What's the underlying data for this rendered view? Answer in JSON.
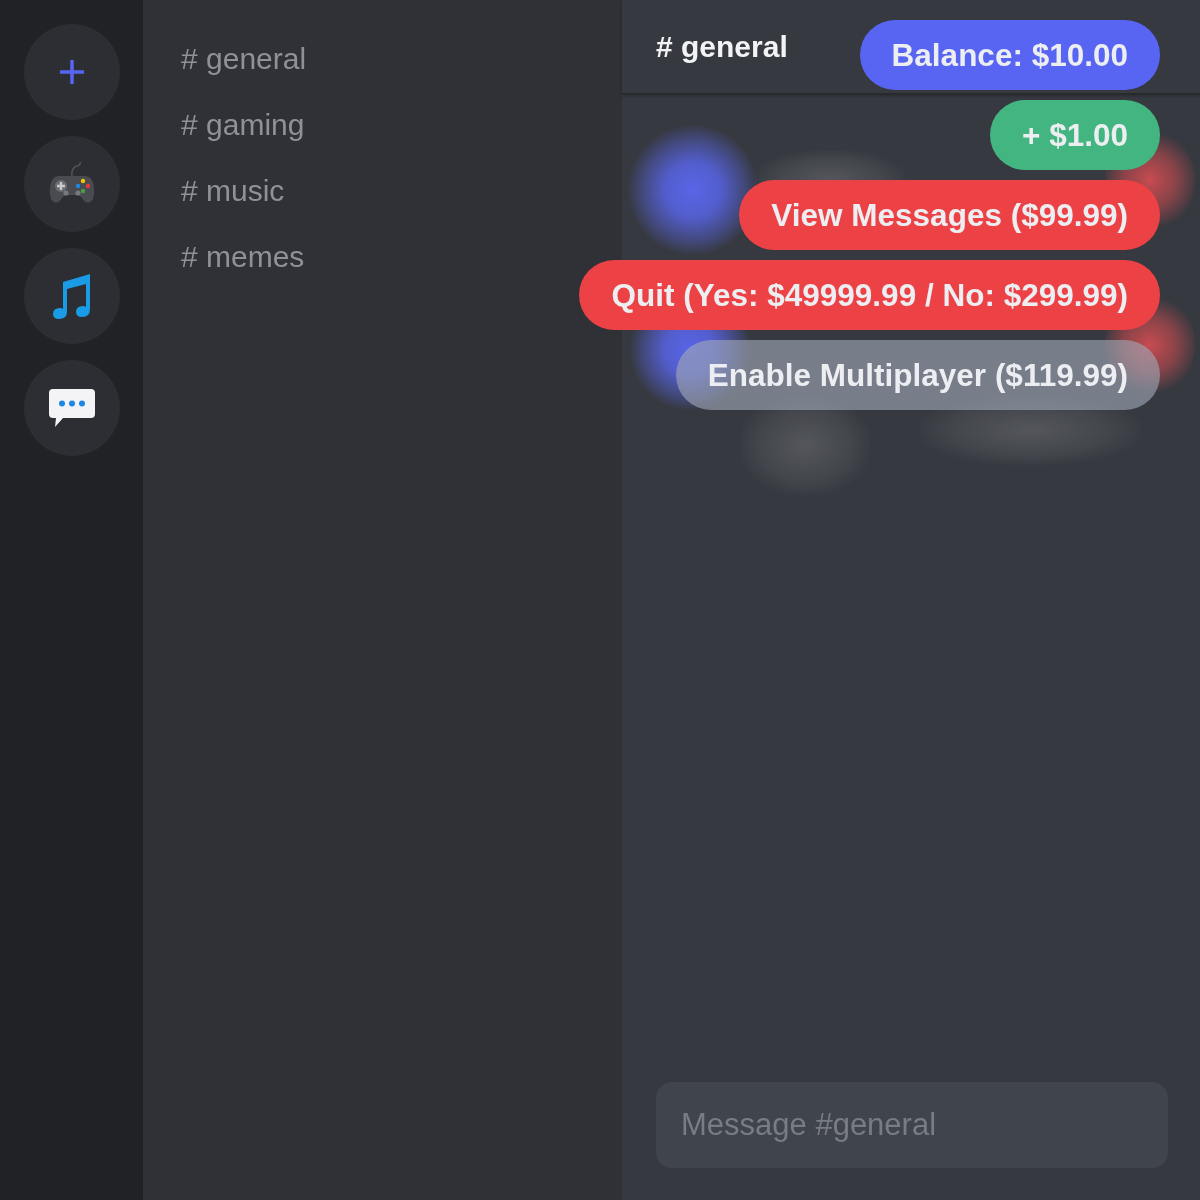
{
  "channels": [
    {
      "name": "# general"
    },
    {
      "name": "# gaming"
    },
    {
      "name": "# music"
    },
    {
      "name": "# memes"
    }
  ],
  "header": {
    "title": "# general"
  },
  "actions": [
    {
      "label": "Balance: $10.00",
      "kind": "balance"
    },
    {
      "label": "+ $1.00",
      "kind": "reward"
    },
    {
      "label": "View Messages ($99.99)",
      "kind": "purchase"
    },
    {
      "label": "Quit (Yes: $49999.99 / No: $299.99)",
      "kind": "purchase"
    },
    {
      "label": "Enable Multiplayer ($119.99)",
      "kind": "locked"
    }
  ],
  "composer": {
    "placeholder": "Message #general"
  }
}
